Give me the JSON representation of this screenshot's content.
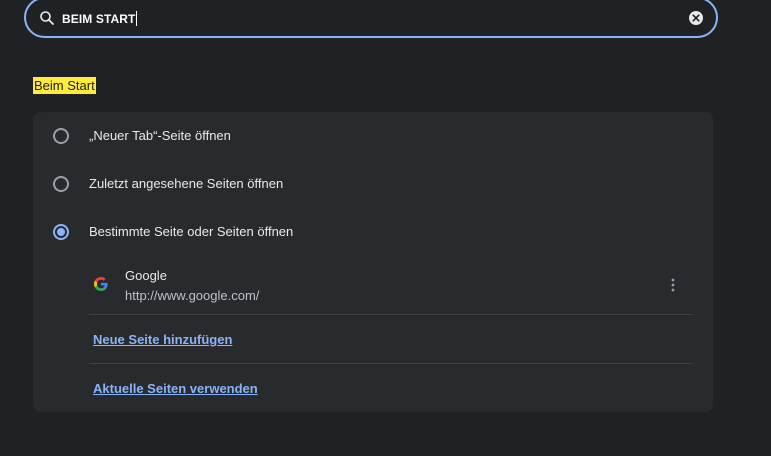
{
  "search": {
    "value": "BEIM START",
    "icon": "search-icon",
    "clear_icon": "clear-icon"
  },
  "section": {
    "title": "Beim Start",
    "highlight_color": "#ffeb3b"
  },
  "startup_options": [
    {
      "label": "„Neuer Tab“-Seite öffnen",
      "checked": false
    },
    {
      "label": "Zuletzt angesehene Seiten öffnen",
      "checked": false
    },
    {
      "label": "Bestimmte Seite oder Seiten öffnen",
      "checked": true
    }
  ],
  "startup_pages": [
    {
      "title": "Google",
      "url": "http://www.google.com/",
      "icon": "google-favicon"
    }
  ],
  "actions": {
    "add_page": "Neue Seite hinzufügen",
    "use_current": "Aktuelle Seiten verwenden"
  },
  "colors": {
    "background": "#202124",
    "card": "#292a2d",
    "accent": "#8ab4f8",
    "text": "#e8eaed",
    "secondary_text": "#bdc1c6"
  }
}
